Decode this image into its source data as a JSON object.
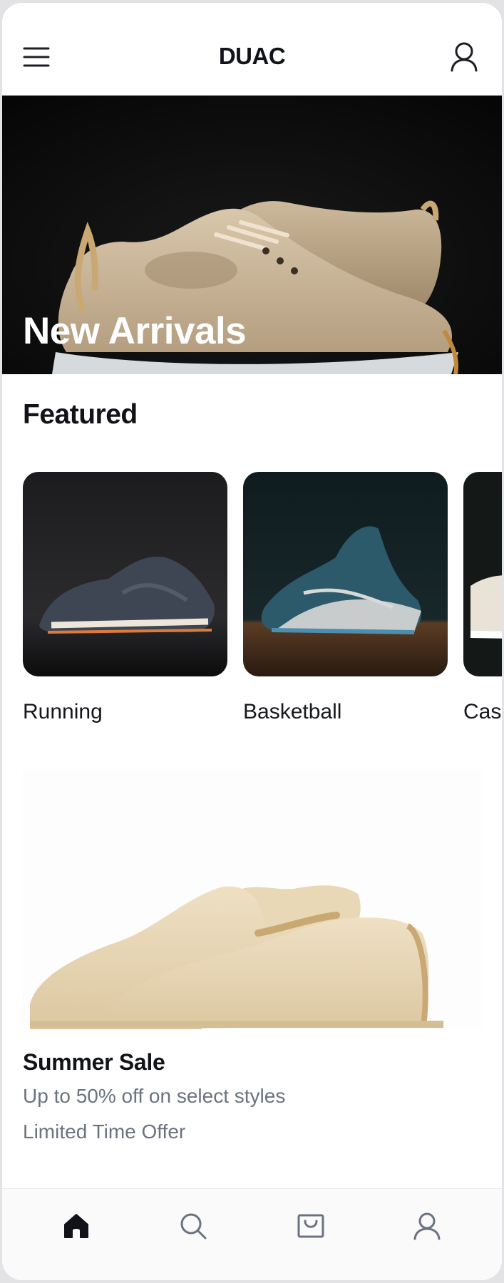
{
  "header": {
    "brand": "DUAC",
    "menu_icon": "hamburger-menu-icon",
    "account_icon": "user-icon"
  },
  "hero": {
    "title": "New Arrivals"
  },
  "featured": {
    "title": "Featured",
    "items": [
      {
        "label": "Running"
      },
      {
        "label": "Basketball"
      },
      {
        "label": "Casual"
      }
    ]
  },
  "promo": {
    "title": "Summer Sale",
    "subtitle": "Up to 50% off on select styles",
    "note": "Limited Time Offer"
  },
  "bottom_nav": {
    "items": [
      {
        "icon": "home-icon",
        "active": true
      },
      {
        "icon": "search-icon",
        "active": false
      },
      {
        "icon": "shopping-bag-icon",
        "active": false
      },
      {
        "icon": "profile-icon",
        "active": false
      }
    ]
  },
  "colors": {
    "text": "#111318",
    "muted": "#6b7280",
    "nav_active": "#111318",
    "nav_inactive": "#6b7280"
  }
}
